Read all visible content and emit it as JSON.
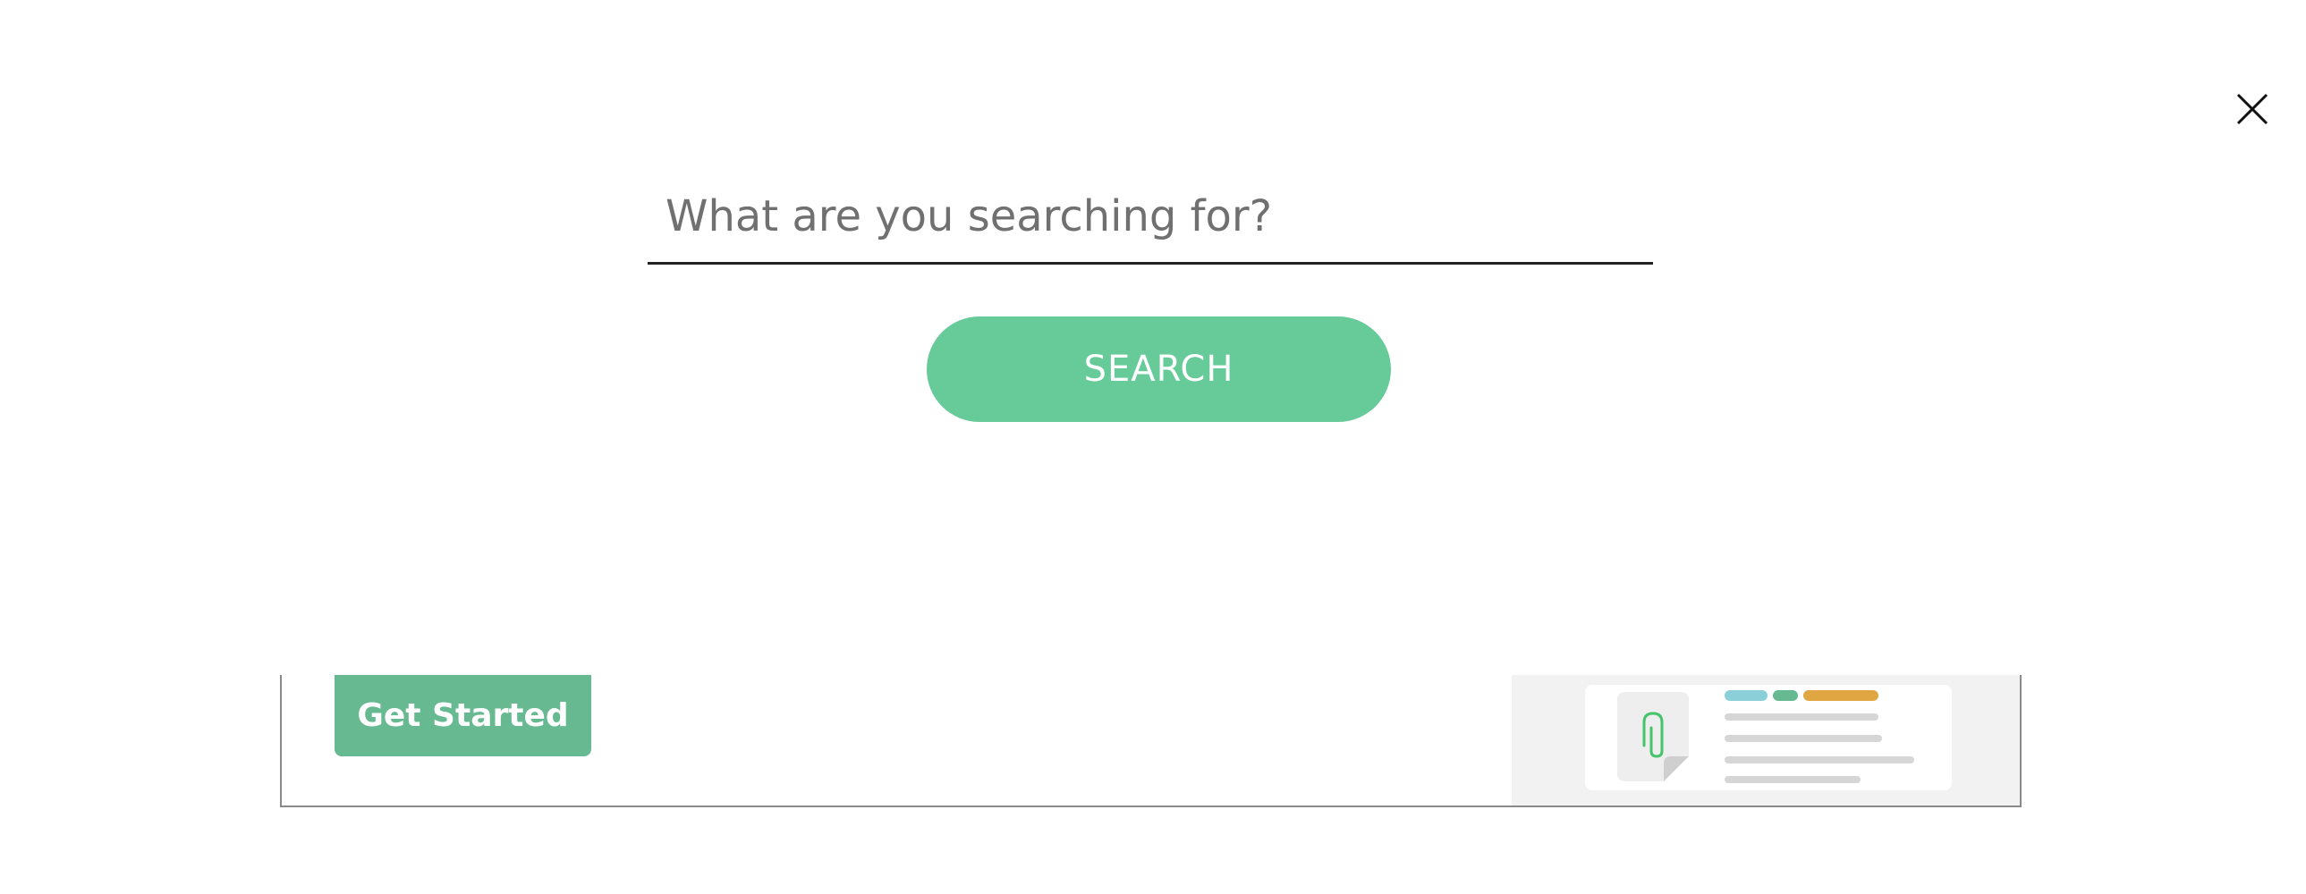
{
  "modal": {
    "close_icon": "close-icon"
  },
  "search": {
    "placeholder": "What are you searching for?",
    "value": "",
    "button_label": "SEARCH"
  },
  "banner": {
    "cta_label": "Get Started",
    "illustration_icon": "paperclip-document-icon"
  },
  "colors": {
    "accent": "#66ca99",
    "cta": "#66b991",
    "pill_blue": "#8bcfd9",
    "pill_green": "#66b991",
    "pill_orange": "#e0a642",
    "clip": "#46c46a"
  }
}
